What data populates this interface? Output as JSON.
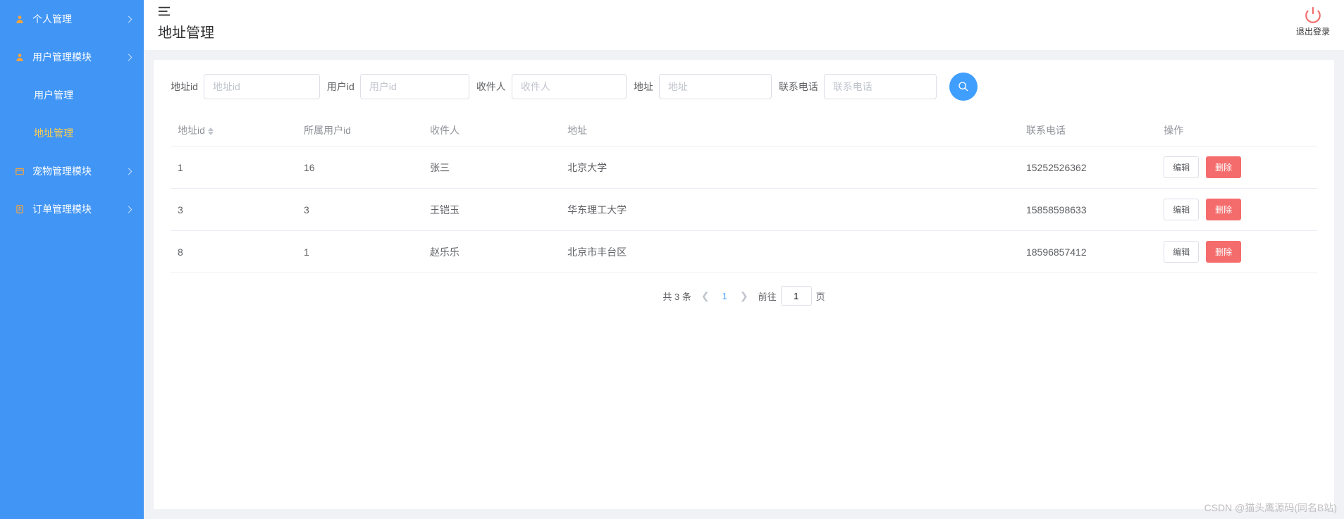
{
  "sidebar": {
    "items": [
      {
        "label": "个人管理",
        "icon": "user-icon",
        "hasSub": true
      },
      {
        "label": "用户管理模块",
        "icon": "user-icon",
        "hasSub": true
      },
      {
        "label": "用户管理",
        "child": true
      },
      {
        "label": "地址管理",
        "child": true,
        "active": true
      },
      {
        "label": "宠物管理模块",
        "icon": "box-icon",
        "hasSub": true
      },
      {
        "label": "订单管理模块",
        "icon": "clipboard-icon",
        "hasSub": true
      }
    ]
  },
  "header": {
    "page_title": "地址管理",
    "logout_label": "退出登录"
  },
  "filters": [
    {
      "label": "地址id",
      "placeholder": "地址id"
    },
    {
      "label": "用户id",
      "placeholder": "用户id"
    },
    {
      "label": "收件人",
      "placeholder": "收件人"
    },
    {
      "label": "地址",
      "placeholder": "地址"
    },
    {
      "label": "联系电话",
      "placeholder": "联系电话"
    }
  ],
  "table": {
    "columns": [
      "地址id",
      "所属用户id",
      "收件人",
      "地址",
      "联系电话",
      "操作"
    ],
    "rows": [
      {
        "id": "1",
        "user_id": "16",
        "recipient": "张三",
        "address": "北京大学",
        "phone": "15252526362"
      },
      {
        "id": "3",
        "user_id": "3",
        "recipient": "王铠玉",
        "address": "华东理工大学",
        "phone": "15858598633"
      },
      {
        "id": "8",
        "user_id": "1",
        "recipient": "赵乐乐",
        "address": "北京市丰台区",
        "phone": "18596857412"
      }
    ],
    "edit_label": "编辑",
    "delete_label": "删除"
  },
  "pagination": {
    "total_text": "共 3 条",
    "current": "1",
    "goto_prefix": "前往",
    "goto_suffix": "页",
    "goto_value": "1"
  },
  "watermark": "CSDN @猫头鹰源码(同名B站)"
}
